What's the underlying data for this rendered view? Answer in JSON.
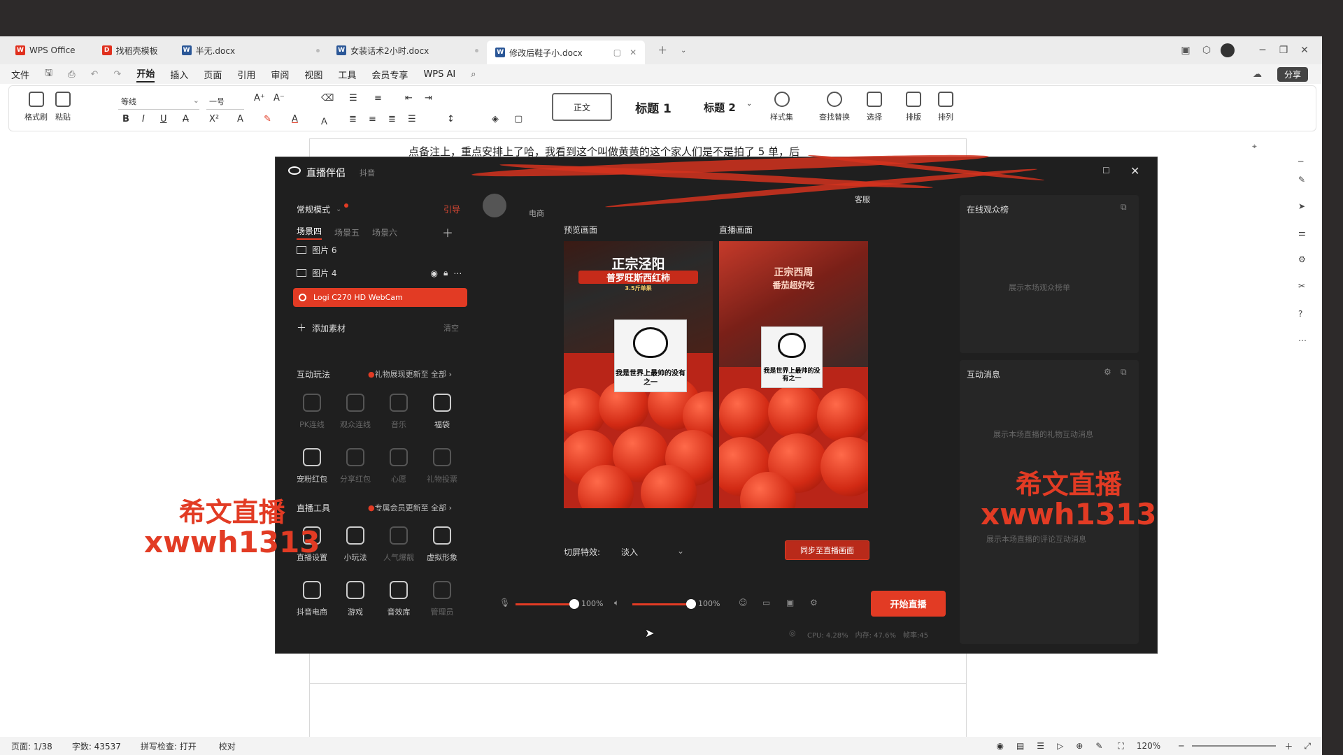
{
  "wps": {
    "tabs": [
      {
        "label": "WPS Office",
        "icon": "wps-logo-icon",
        "color": "#e0301e"
      },
      {
        "label": "找稻壳模板",
        "icon": "docer-icon",
        "color": "#e0301e"
      },
      {
        "label": "半无.docx",
        "icon": "word-icon",
        "color": "#2b5797"
      },
      {
        "label": "女装话术2小时.docx",
        "icon": "word-icon",
        "color": "#2b5797"
      },
      {
        "label": "修改后鞋子小.docx",
        "icon": "word-icon",
        "color": "#2b5797"
      }
    ],
    "menu": [
      "文件",
      "开始",
      "插入",
      "页面",
      "引用",
      "审阅",
      "视图",
      "工具",
      "会员专享",
      "WPS AI"
    ],
    "active_menu": "开始",
    "share_label": "分享",
    "ribbon": {
      "format_painter": "格式刷",
      "paste": "粘贴",
      "font_name": "等线",
      "font_size": "一号",
      "style_normal": "正文",
      "style_h1": "标题 1",
      "style_h2": "标题 2",
      "style_set": "样式集",
      "find_replace": "查找替换",
      "select": "选择",
      "layout": "排版",
      "arrange": "排列"
    },
    "doc_text": "点备注上，重点安排上了哈，我看到这个叫做黄黄的这个家人们是不是拍了 5 单，后",
    "status": {
      "page": "页面: 1/38",
      "words": "字数: 43537",
      "spell": "拼写检查: 打开",
      "proof": "校对",
      "zoom": "120%"
    }
  },
  "live": {
    "title": "直播伴侣",
    "title_sub": "抖音",
    "mode": "常规模式",
    "guide": "引导",
    "scenes": [
      "场景四",
      "场景五",
      "场景六"
    ],
    "sources": [
      {
        "label": "图片 6",
        "active": false
      },
      {
        "label": "图片 4",
        "active": false
      },
      {
        "label": "Logi C270 HD WebCam",
        "active": true
      }
    ],
    "add_source": "添加素材",
    "clear": "清空",
    "user_name": "电商",
    "service": "客服",
    "interactive": {
      "title": "互动玩法",
      "note": "礼物展现更新至",
      "all": "全部",
      "items": [
        {
          "label": "PK连线",
          "icon": "pk-icon",
          "dim": true
        },
        {
          "label": "观众连线",
          "icon": "guest-link-icon",
          "dim": true
        },
        {
          "label": "音乐",
          "icon": "music-icon",
          "dim": true
        },
        {
          "label": "福袋",
          "icon": "lucky-bag-icon",
          "dim": false
        },
        {
          "label": "宠粉红包",
          "icon": "red-packet-icon",
          "dim": false
        },
        {
          "label": "分享红包",
          "icon": "share-packet-icon",
          "dim": true
        },
        {
          "label": "心愿",
          "icon": "wish-icon",
          "dim": true
        },
        {
          "label": "礼物投票",
          "icon": "vote-icon",
          "dim": true
        }
      ]
    },
    "tools": {
      "title": "直播工具",
      "note": "专属会员更新至",
      "all": "全部",
      "items": [
        {
          "label": "直播设置",
          "icon": "settings-icon",
          "dim": false
        },
        {
          "label": "小玩法",
          "icon": "mini-game-icon",
          "dim": false
        },
        {
          "label": "人气爆靓",
          "icon": "popularity-icon",
          "dim": true
        },
        {
          "label": "虚拟形象",
          "icon": "avatar-icon",
          "dim": false
        },
        {
          "label": "抖音电商",
          "icon": "cart-icon",
          "dim": false
        },
        {
          "label": "游戏",
          "icon": "gamepad-icon",
          "dim": false
        },
        {
          "label": "音效库",
          "icon": "sound-effect-icon",
          "dim": false
        },
        {
          "label": "管理员",
          "icon": "admin-icon",
          "dim": true
        }
      ]
    },
    "preview_label": "预览画面",
    "live_label": "直播画面",
    "preview_banner": "正宗泾阳",
    "preview_banner2": "普罗旺斯西红柿",
    "preview_banner3": "3.5斤单果",
    "live_banner": "正宗西周",
    "live_banner2": "番茄超好吃",
    "panda_caption": "我是世界上最帅的没有之一",
    "transition_label": "切屏特效:",
    "transition_value": "淡入",
    "sync_button": "同步至直播画面",
    "mic_volume": "100%",
    "speaker_volume": "100%",
    "mic_level": 1.0,
    "speaker_level": 1.0,
    "start_button": "开始直播",
    "stats": "CPU: 4.28%　内存: 47.6%　帧率:45",
    "audience_title": "在线观众榜",
    "audience_empty": "展示本场观众榜单",
    "messages_title": "互动消息",
    "messages_empty": "展示本场直播的礼物互动消息",
    "messages_empty2": "展示本场直播的评论互动消息"
  },
  "watermark": {
    "name": "希文直播",
    "id": "xwwh1313",
    "color": "#e23b24"
  }
}
